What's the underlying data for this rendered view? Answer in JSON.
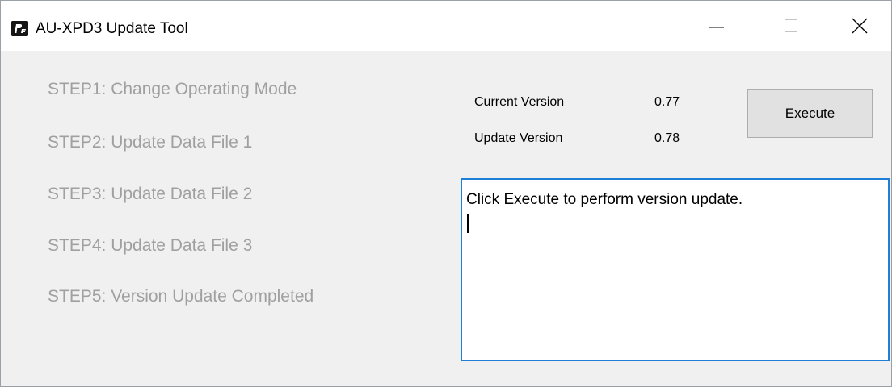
{
  "window": {
    "title": "AU-XPD3 Update Tool"
  },
  "title_controls": {
    "minimize_icon": "minimize-icon",
    "maximize_icon": "maximize-icon",
    "close_icon": "close-icon"
  },
  "steps": [
    "STEP1: Change Operating Mode",
    "STEP2: Update Data File 1",
    "STEP3: Update Data File 2",
    "STEP4: Update Data File 3",
    "STEP5: Version Update Completed"
  ],
  "versions": {
    "current_label": "Current Version",
    "current_value": "0.77",
    "update_label": "Update Version",
    "update_value": "0.78"
  },
  "execute_button": {
    "label": "Execute"
  },
  "log": {
    "text": "Click Execute to perform version update."
  },
  "colors": {
    "step_text_disabled": "#a0a0a0",
    "log_border_focus": "#1f7ed6",
    "button_face": "#e1e1e1",
    "window_background": "#f0f0f0"
  }
}
